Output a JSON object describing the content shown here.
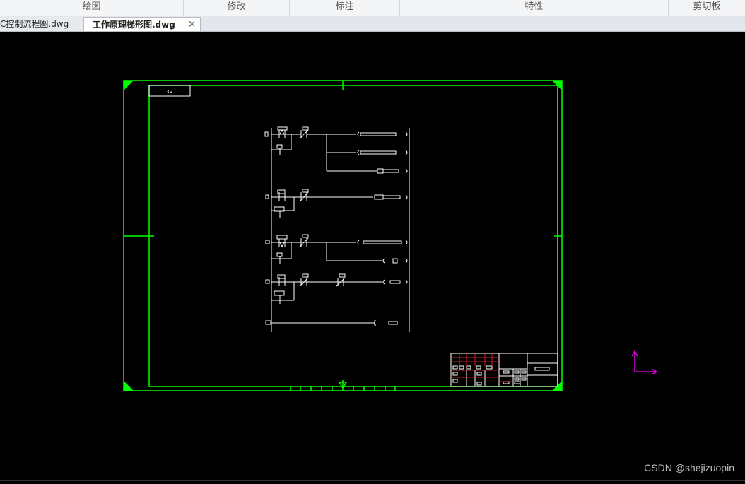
{
  "ribbon": {
    "groups": [
      "绘图",
      "修改",
      "标注",
      "特性",
      "剪切板"
    ]
  },
  "tabs": [
    {
      "label": "C控制流程图.dwg",
      "active": false
    },
    {
      "label": "工作原理梯形图.dwg",
      "active": true,
      "close": "×"
    }
  ],
  "drawing": {
    "frame_color": "#00ff00",
    "line_color": "#ffffff",
    "ucs_color": "#ff00ff",
    "corner_label": "3V"
  },
  "watermark": "CSDN @shejizuopin"
}
